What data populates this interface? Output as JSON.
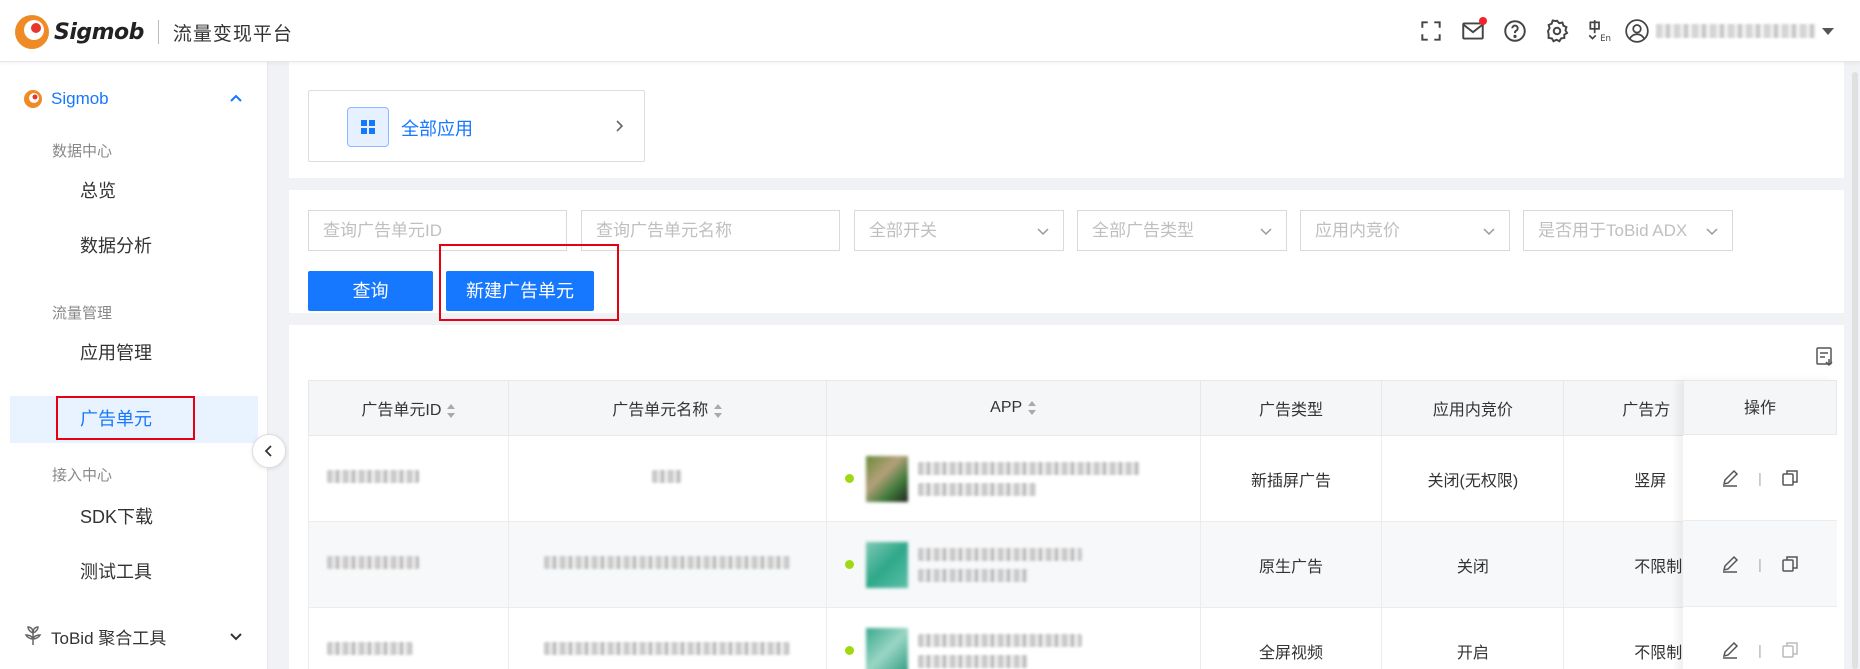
{
  "header": {
    "brand": "Sigmob",
    "platform_name": "流量变现平台",
    "icons": [
      "fullscreen-icon",
      "mail-icon",
      "help-icon",
      "settings-icon",
      "language-icon",
      "user-icon"
    ]
  },
  "sidebar": {
    "group1": {
      "label": "Sigmob"
    },
    "categories": {
      "data_center": "数据中心",
      "traffic_mgmt": "流量管理",
      "access_center": "接入中心"
    },
    "items": {
      "overview": "总览",
      "data_analysis": "数据分析",
      "app_mgmt": "应用管理",
      "ad_unit": "广告单元",
      "sdk_download": "SDK下载",
      "test_tools": "测试工具"
    },
    "group2": {
      "label": "ToBid 聚合工具"
    }
  },
  "app_selector": {
    "label": "全部应用"
  },
  "filters": {
    "unit_id_placeholder": "查询广告单元ID",
    "unit_name_placeholder": "查询广告单元名称",
    "switch": "全部开关",
    "ad_type": "全部广告类型",
    "bidding": "应用内竞价",
    "tobid_adx": "是否用于ToBid ADX"
  },
  "buttons": {
    "query": "查询",
    "create": "新建广告单元"
  },
  "table": {
    "columns": [
      "广告单元ID",
      "广告单元名称",
      "APP",
      "广告类型",
      "应用内竞价",
      "广告方"
    ],
    "op_header": "操作",
    "rows": [
      {
        "ad_type": "新插屏广告",
        "bidding": "关闭(无权限)",
        "orientation": "竖屏"
      },
      {
        "ad_type": "原生广告",
        "bidding": "关闭",
        "orientation": "不限制"
      },
      {
        "ad_type": "全屏视频",
        "bidding": "开启",
        "orientation": "不限制"
      }
    ]
  },
  "colors": {
    "accent": "#1677ff",
    "highlight": "#e60012",
    "status_dot": "#a0d911"
  }
}
